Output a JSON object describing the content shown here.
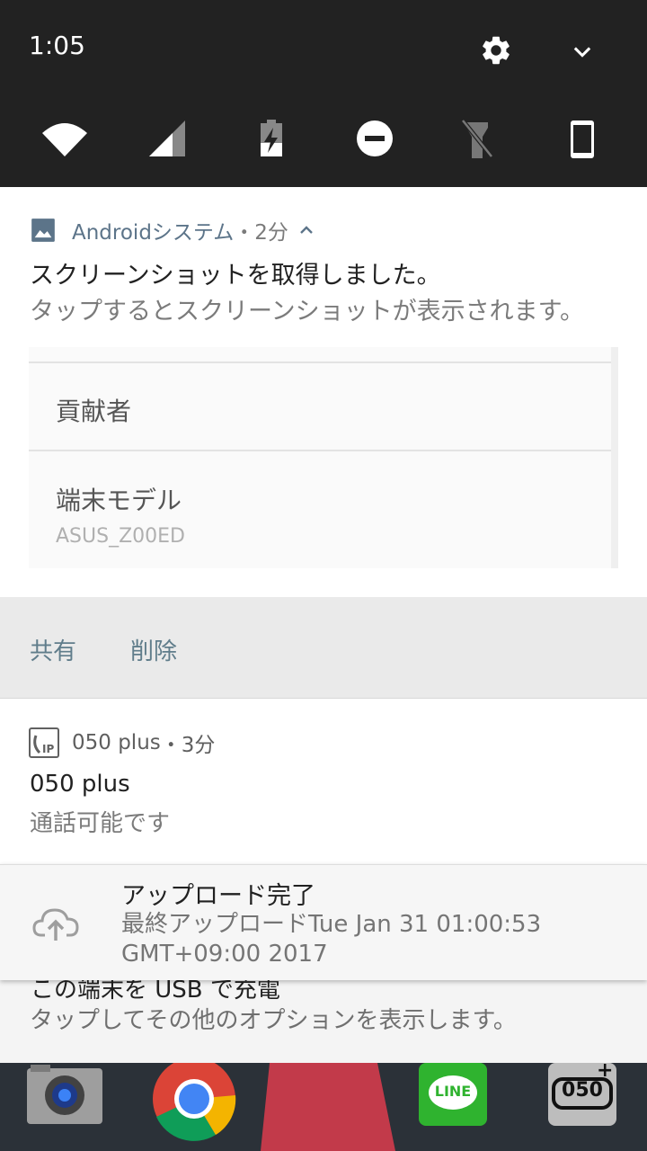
{
  "status_bar": {
    "time": "1:05",
    "quick_settings": [
      "wifi-icon",
      "cellular-signal-icon",
      "battery-charging-icon",
      "do-not-disturb-icon",
      "flashlight-off-icon",
      "auto-rotate-icon"
    ]
  },
  "notifications": [
    {
      "app": "Androidシステム",
      "time": "・2分",
      "title": "スクリーンショットを取得しました。",
      "text": "タップするとスクリーンショットが表示されます。",
      "preview": {
        "row1_label": "貢献者",
        "row2_label": "端末モデル",
        "row2_value": "ASUS_Z00ED"
      },
      "actions": [
        "共有",
        "削除"
      ]
    },
    {
      "app": "050 plus",
      "time": "・3分",
      "title": "050 plus",
      "text": "通話可能です"
    },
    {
      "title": "アップロード完了",
      "text": "最終アップロードTue Jan 31 01:00:53 GMT+09:00 2017"
    },
    {
      "title": "この端末を USB で充電",
      "text": "タップしてその他のオプションを表示します。"
    }
  ],
  "dock": {
    "line_label": "LINE",
    "app_050_label": "050"
  },
  "colors": {
    "status_bar": "#222222",
    "accent": "#607d8b",
    "line_green": "#2fb32f"
  }
}
